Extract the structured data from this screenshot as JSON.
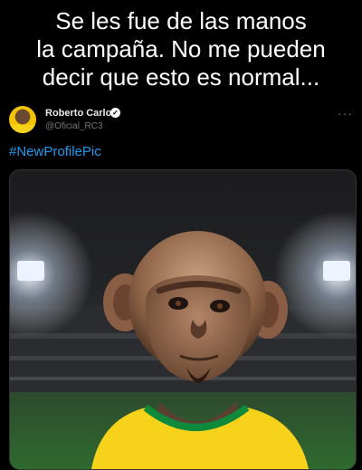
{
  "caption": {
    "line1": "Se les fue de las manos",
    "line2": "la campaña. No me pueden",
    "line3": "decir que esto es normal..."
  },
  "tweet": {
    "user_name": "Roberto Carlos",
    "handle": "@Oficial_RC3",
    "more_label": "···",
    "hashtag": "#NewProfilePic"
  },
  "colors": {
    "background": "#000000",
    "hashtag": "#1d9bf0",
    "handle": "#71767b",
    "jersey_yellow": "#f7d21b",
    "jersey_green": "#0f8a3a"
  },
  "icons": {
    "verified": "verified-badge-icon",
    "more": "more-options-icon"
  }
}
